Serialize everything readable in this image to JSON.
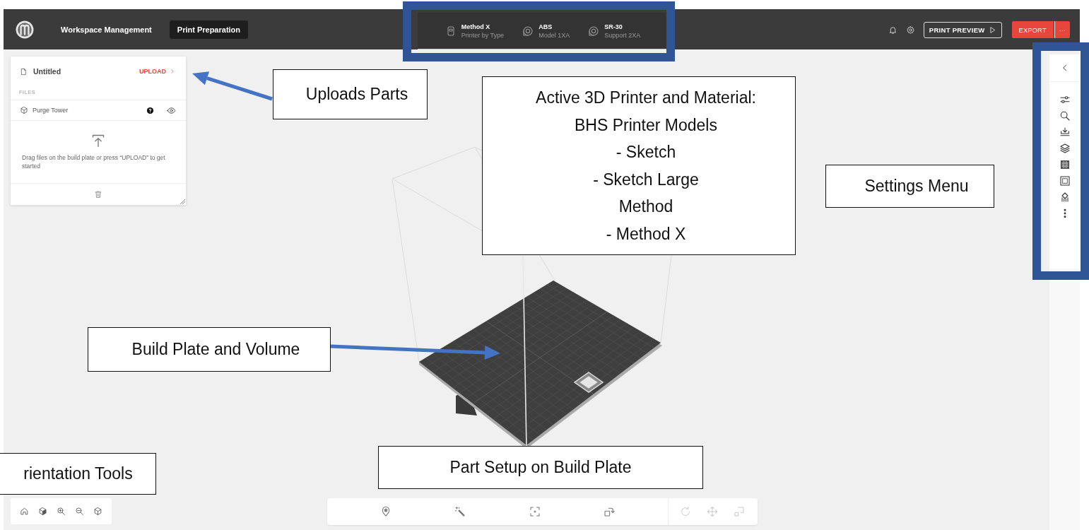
{
  "topbar": {
    "tabs": [
      {
        "label": "Workspace Management",
        "selected": false
      },
      {
        "label": "Print Preparation",
        "selected": true
      }
    ],
    "machine": [
      {
        "title": "Method X",
        "subtitle": "Printer by Type"
      },
      {
        "title": "ABS",
        "subtitle": "Model 1XA"
      },
      {
        "title": "SR-30",
        "subtitle": "Support 2XA"
      }
    ],
    "preview_button": "PRINT PREVIEW",
    "export_button": "EXPORT",
    "more_button": "···"
  },
  "files_panel": {
    "title": "Untitled",
    "upload": "UPLOAD",
    "section": "FILES",
    "files": [
      {
        "name": "Purge Tower"
      }
    ],
    "empty_hint": "Drag files on the build plate or press “UPLOAD” to get started"
  },
  "part_tools": [
    {
      "disabled": false
    },
    {
      "disabled": false
    },
    {
      "disabled": false
    },
    {
      "disabled": false
    },
    {
      "disabled": true
    },
    {
      "disabled": true
    },
    {
      "disabled": true
    }
  ],
  "annotations": [
    {
      "kind": "frame"
    },
    {
      "kind": "callout",
      "lines": [
        "Uploads Parts"
      ]
    },
    {
      "kind": "arrow"
    },
    {
      "kind": "callout",
      "lines": [
        "Active 3D Printer and Material:",
        "BHS Printer Models",
        "- Sketch",
        "- Sketch Large",
        "Method",
        "- Method X"
      ]
    },
    {
      "kind": "callout",
      "lines": [
        "Settings Menu"
      ]
    },
    {
      "kind": "frame"
    },
    {
      "kind": "callout",
      "lines": [
        "Build Plate and Volume"
      ]
    },
    {
      "kind": "arrow"
    },
    {
      "kind": "callout",
      "lines": [
        "rientation Tools"
      ]
    },
    {
      "kind": "callout",
      "lines": [
        "Part Setup on Build Plate"
      ]
    }
  ]
}
